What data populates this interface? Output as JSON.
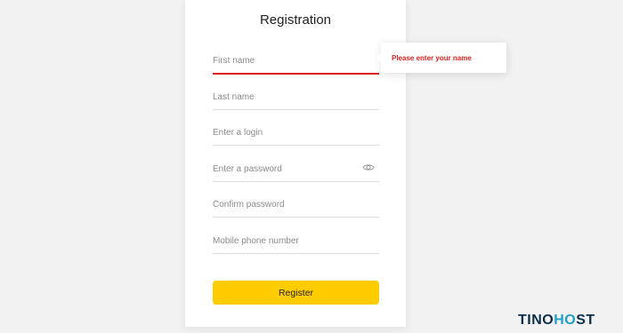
{
  "form": {
    "title": "Registration",
    "fields": [
      {
        "placeholder": "First name",
        "value": ""
      },
      {
        "placeholder": "Last name",
        "value": ""
      },
      {
        "placeholder": "Enter a login",
        "value": ""
      },
      {
        "placeholder": "Enter a password",
        "value": ""
      },
      {
        "placeholder": "Confirm password",
        "value": ""
      },
      {
        "placeholder": "Mobile phone number",
        "value": ""
      }
    ],
    "register_label": "Register"
  },
  "tooltip": {
    "message": "Please enter your name"
  },
  "watermark": {
    "part1": "TINO",
    "part2": "H",
    "part3": "ST"
  },
  "colors": {
    "accent": "#ffcc00",
    "error": "#e02020",
    "background": "#f2f2f2"
  },
  "icons": {
    "password_toggle": "eye-icon"
  }
}
